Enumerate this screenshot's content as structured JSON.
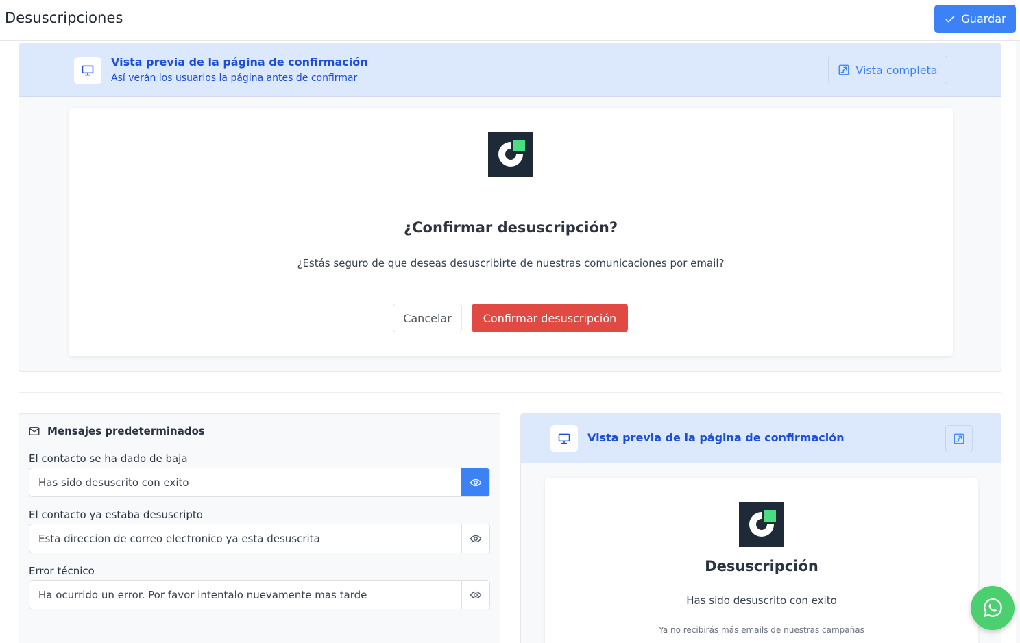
{
  "header": {
    "title": "Desuscripciones",
    "save_label": "Guardar"
  },
  "preview": {
    "title": "Vista previa de la página de confirmación",
    "subtitle": "Así verán los usuarios la página antes de confirmar",
    "full_view_label": "Vista completa",
    "confirm_title": "¿Confirmar desuscripción?",
    "confirm_text": "¿Estás seguro de que deseas desuscribirte de nuestras comunicaciones por email?",
    "cancel_label": "Cancelar",
    "confirm_label": "Confirmar desuscripción"
  },
  "messages": {
    "title": "Mensajes predeterminados",
    "fields": [
      {
        "label": "El contacto se ha dado de baja",
        "value": "Has sido desuscrito con exito",
        "active": true
      },
      {
        "label": "El contacto ya estaba desuscripto",
        "value": "Esta direccion de correo electronico ya esta desuscrita",
        "active": false
      },
      {
        "label": "Error técnico",
        "value": "Ha ocurrido un error. Por favor intentalo nuevamente mas tarde",
        "active": false
      }
    ]
  },
  "result_preview": {
    "title": "Vista previa de la página de confirmación",
    "heading": "Desuscripción",
    "message": "Has sido desuscrito con exito",
    "note": "Ya no recibirás más emails de nuestras campañas"
  },
  "colors": {
    "primary": "#3b82f6",
    "danger": "#e14a43",
    "preview_header": "#dce8fb",
    "logo_bg": "#1e2a38",
    "logo_accent": "#4ade80",
    "whatsapp": "#4ccf6e"
  },
  "icons": [
    "check-icon",
    "monitor-icon",
    "external-link-icon",
    "mail-icon",
    "eye-icon",
    "whatsapp-icon",
    "logo-icon"
  ]
}
